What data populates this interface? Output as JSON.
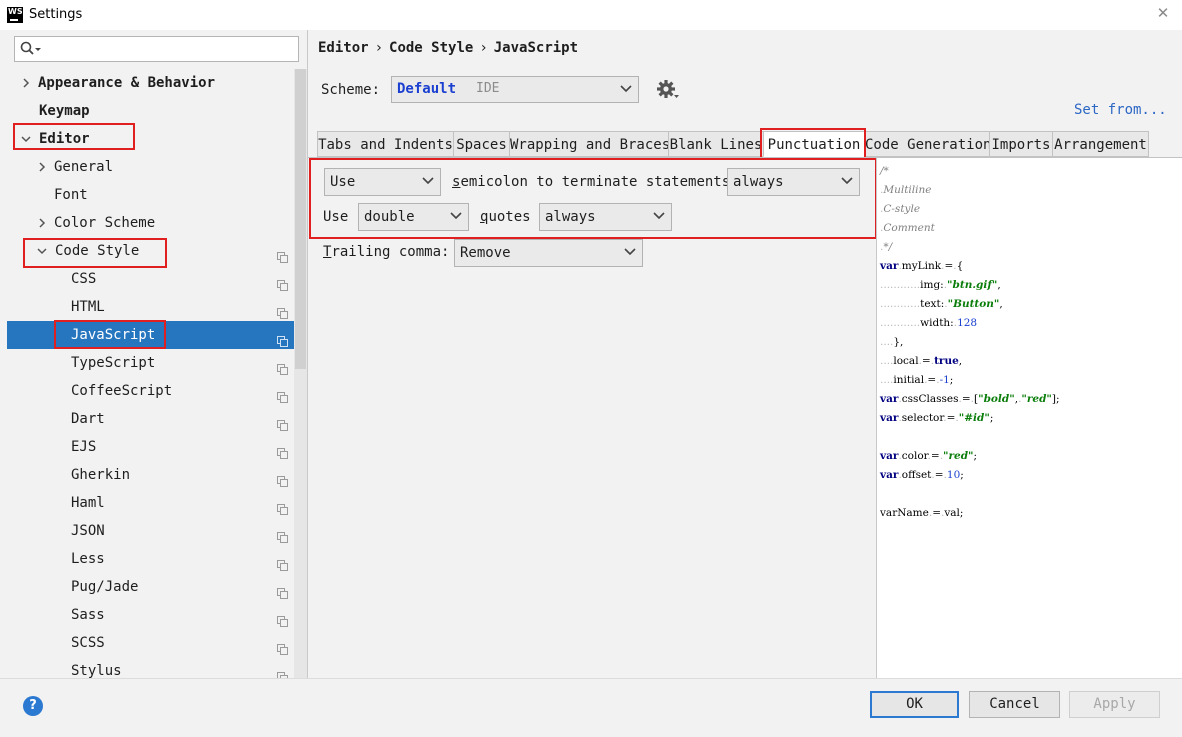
{
  "window": {
    "title": "Settings",
    "app_icon_text": "WS"
  },
  "search": {
    "placeholder": ""
  },
  "sidebar": {
    "items": [
      {
        "label": "Appearance & Behavior",
        "arrow": ">"
      },
      {
        "label": "Keymap",
        "arrow": ""
      },
      {
        "label": "Editor",
        "arrow": "v"
      },
      {
        "label": "General",
        "arrow": ">"
      },
      {
        "label": "Font",
        "arrow": ""
      },
      {
        "label": "Color Scheme",
        "arrow": ">"
      },
      {
        "label": "Code Style",
        "arrow": "v"
      },
      {
        "label": "CSS"
      },
      {
        "label": "HTML"
      },
      {
        "label": "JavaScript"
      },
      {
        "label": "TypeScript"
      },
      {
        "label": "CoffeeScript"
      },
      {
        "label": "Dart"
      },
      {
        "label": "EJS"
      },
      {
        "label": "Gherkin"
      },
      {
        "label": "Haml"
      },
      {
        "label": "JSON"
      },
      {
        "label": "Less"
      },
      {
        "label": "Pug/Jade"
      },
      {
        "label": "Sass"
      },
      {
        "label": "SCSS"
      },
      {
        "label": "Stylus"
      }
    ]
  },
  "breadcrumb": [
    "Editor",
    "Code Style",
    "JavaScript"
  ],
  "breadcrumb_sep": "›",
  "scheme": {
    "label": "Scheme:",
    "name": "Default",
    "sub": "IDE",
    "set_from": "Set from..."
  },
  "tabs": [
    "Tabs and Indents",
    "Spaces",
    "Wrapping and Braces",
    "Blank Lines",
    "Punctuation",
    "Code Generation",
    "Imports",
    "Arrangement"
  ],
  "active_tab": "Punctuation",
  "punctuation": {
    "row1": {
      "select1": "Use",
      "label_u": "s",
      "label_rest": "emicolon to terminate statements",
      "select2": "always"
    },
    "row2": {
      "label": "Use",
      "select1": "double",
      "label_u": "q",
      "label_rest": "uotes",
      "select2": "always"
    },
    "row3": {
      "label_u": "T",
      "label_rest": "railing comma:",
      "select": "Remove"
    }
  },
  "preview_lines": [
    "/*",
    " Multiline",
    " C-style",
    " Comment",
    " */",
    "var myLink = {",
    "    img: \"btn.gif\",",
    "    text: \"Button\",",
    "    width: 128",
    "},",
    "local = true,",
    "initial = -1;",
    "var cssClasses = [\"bold\", \"red\"];",
    "var selector = \"#id\";",
    "",
    "var color = \"red\";",
    "var offset = 10;",
    "",
    "varName = val;"
  ],
  "buttons": {
    "ok": "OK",
    "cancel": "Cancel",
    "apply": "Apply"
  },
  "help": "?",
  "colors": {
    "accent": "#2675bf",
    "highlight_box": "#e02020",
    "link": "#2c67c5"
  }
}
